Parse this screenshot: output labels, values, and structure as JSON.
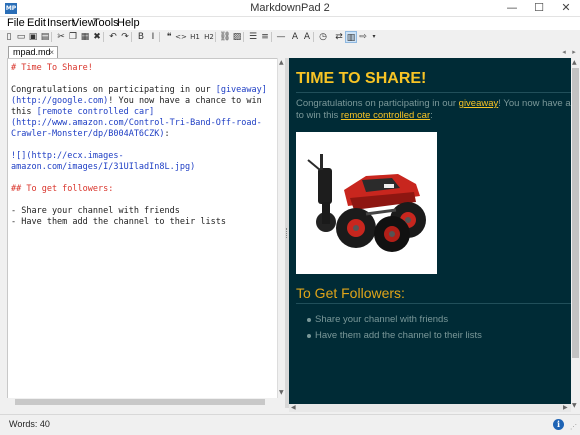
{
  "window": {
    "title": "MarkdownPad 2",
    "app_icon_text": "MP",
    "controls": {
      "minimize": "—",
      "maximize": "☐",
      "close": "✕"
    }
  },
  "menu": [
    "File",
    "Edit",
    "Insert",
    "View",
    "Tools",
    "Help"
  ],
  "toolbar": {
    "icons": [
      {
        "name": "new-file-icon",
        "glyph": "▯"
      },
      {
        "name": "open-folder-icon",
        "glyph": "▭"
      },
      {
        "name": "save-icon",
        "glyph": "▣"
      },
      {
        "name": "save-all-icon",
        "glyph": "▤"
      },
      {
        "name": "cut-icon",
        "glyph": "✂"
      },
      {
        "name": "copy-icon",
        "glyph": "❐"
      },
      {
        "name": "paste-icon",
        "glyph": "▦"
      },
      {
        "name": "delete-icon",
        "glyph": "✖"
      },
      {
        "name": "undo-icon",
        "glyph": "↶"
      },
      {
        "name": "redo-icon",
        "glyph": "↷"
      },
      {
        "name": "bold-icon",
        "glyph": "B"
      },
      {
        "name": "italic-icon",
        "glyph": "I"
      },
      {
        "name": "quote-icon",
        "glyph": "❝"
      },
      {
        "name": "code-icon",
        "glyph": "<>"
      },
      {
        "name": "heading1-icon",
        "glyph": "H1"
      },
      {
        "name": "heading2-icon",
        "glyph": "H2"
      },
      {
        "name": "link-icon",
        "glyph": "⛓"
      },
      {
        "name": "image-icon",
        "glyph": "▨"
      },
      {
        "name": "bullet-list-icon",
        "glyph": "☰"
      },
      {
        "name": "numbered-list-icon",
        "glyph": "≡"
      },
      {
        "name": "horizontal-rule-icon",
        "glyph": "—"
      },
      {
        "name": "font-larger-icon",
        "glyph": "A"
      },
      {
        "name": "font-smaller-icon",
        "glyph": "A"
      },
      {
        "name": "timestamp-icon",
        "glyph": "◷"
      },
      {
        "name": "split-view-icon",
        "glyph": "⇄"
      },
      {
        "name": "live-preview-icon",
        "glyph": "▥"
      },
      {
        "name": "export-icon",
        "glyph": "⇨"
      }
    ],
    "overflow": "▾"
  },
  "tabs": [
    {
      "label": "mpad.md",
      "dirty_marker": "●",
      "close": "×"
    }
  ],
  "tab_nav": {
    "prev": "◂",
    "next": "▸"
  },
  "editor": {
    "lines": [
      {
        "text": "# Time To Share!",
        "style": "head"
      },
      {
        "text": "",
        "style": "text"
      },
      {
        "parts": [
          {
            "t": "Congratulations on participating in our ",
            "s": "text"
          },
          {
            "t": "[giveaway](http://google.com)",
            "s": "link"
          },
          {
            "t": "! You now have a chance to win this ",
            "s": "text"
          },
          {
            "t": "[remote controlled car](http://www.amazon.com/Control-Tri-Band-Off-road-Crawler-Monster/dp/B004AT6CZK)",
            "s": "link"
          },
          {
            "t": ":",
            "s": "text"
          }
        ]
      },
      {
        "text": "",
        "style": "text"
      },
      {
        "text": "![](http://ecx.images-amazon.com/images/I/31UIladIn8L.jpg)",
        "style": "link"
      },
      {
        "text": "",
        "style": "text"
      },
      {
        "text": "## To get followers:",
        "style": "head"
      },
      {
        "text": "",
        "style": "text"
      },
      {
        "text": "- Share your channel with friends",
        "style": "text"
      },
      {
        "text": "- Have them add the channel to their lists",
        "style": "text"
      }
    ]
  },
  "preview": {
    "h1": "TIME TO SHARE!",
    "p_line1_before": "Congratulations on participating in our ",
    "p_link1": "giveaway",
    "p_line1_after": "! You now have a chance",
    "p_line2_before": "to win this ",
    "p_link2": "remote controlled car",
    "p_line2_after": ":",
    "h2": "To Get Followers:",
    "list": [
      "Share your channel with friends",
      "Have them add the channel to their lists"
    ],
    "image_icon": "rc-car-image"
  },
  "status": {
    "words": "Words: 40",
    "info_icon": "i"
  },
  "colors": {
    "preview_bg": "#002b36",
    "heading": "#f8c425",
    "body_text": "#7a9899",
    "md_heading": "#d9342b",
    "md_link": "#1e3ec4"
  }
}
